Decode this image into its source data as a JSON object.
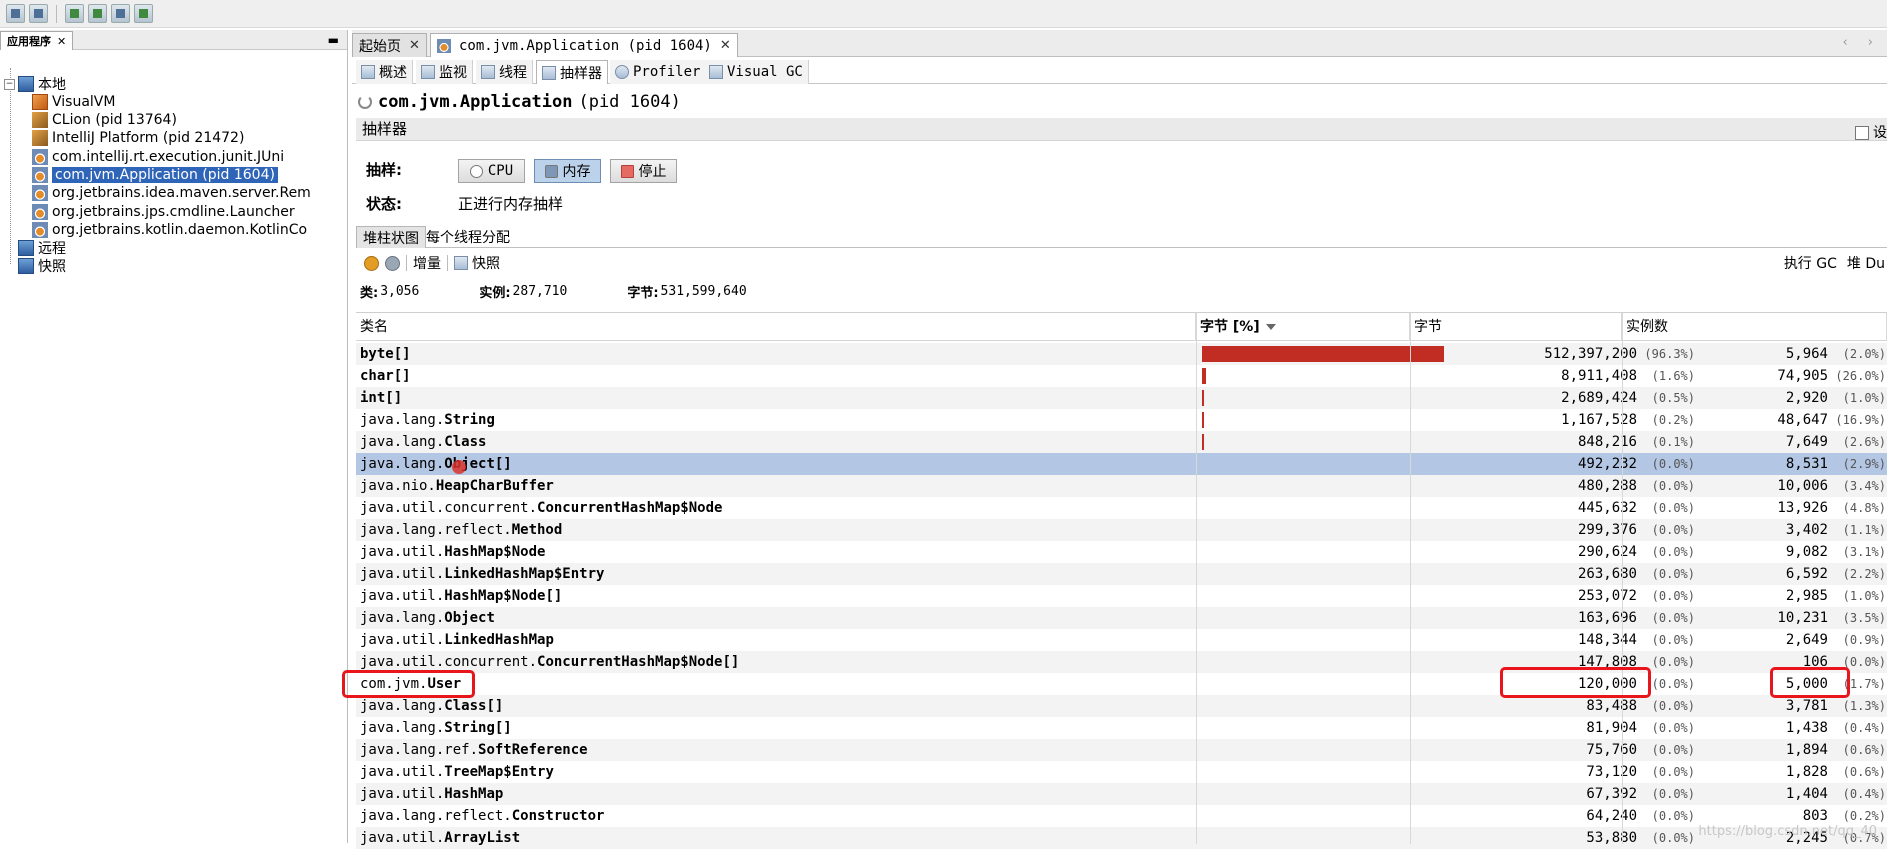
{
  "left_panel": {
    "tab_label": "应用程序",
    "tab_close": "✕",
    "minimize": "▬",
    "local": "本地",
    "remote": "远程",
    "snapshots": "快照",
    "items": [
      {
        "label": "VisualVM"
      },
      {
        "label": "CLion (pid 13764)"
      },
      {
        "label": "IntelliJ Platform (pid 21472)"
      },
      {
        "label": "com.intellij.rt.execution.junit.JUni"
      },
      {
        "label": "com.jvm.Application (pid 1604)"
      },
      {
        "label": "org.jetbrains.idea.maven.server.Rem"
      },
      {
        "label": "org.jetbrains.jps.cmdline.Launcher"
      },
      {
        "label": "org.jetbrains.kotlin.daemon.KotlinCo"
      }
    ]
  },
  "doc_tabs": {
    "start_page": "起始页",
    "app_tab": "com.jvm.Application (pid 1604)",
    "close": "✕",
    "nav": "‹ ›"
  },
  "sub_tabs": [
    "概述",
    "监视",
    "线程",
    "抽样器",
    "Profiler",
    "Visual GC"
  ],
  "app_title": {
    "name": "com.jvm.Application",
    "pid": "(pid 1604)"
  },
  "sampler": {
    "header": "抽样器",
    "settings": "设",
    "sample_label": "抽样:",
    "cpu_btn": "CPU",
    "mem_btn": "内存",
    "stop_btn": "停止",
    "status_label": "状态:",
    "status_value": "正进行内存抽样"
  },
  "view_tabs": [
    "堆柱状图",
    "每个线程分配"
  ],
  "tools": {
    "delta": "增量",
    "snapshot": "快照",
    "gc": "执行 GC",
    "heap": "堆 Du"
  },
  "stats": {
    "classes_label": "类:",
    "classes": "3,056",
    "instances_label": "实例:",
    "instances": "287,710",
    "bytes_label": "字节:",
    "bytes": "531,599,640"
  },
  "table": {
    "columns": {
      "name": "类名",
      "bytes_pct": "字节 [%]",
      "bytes": "字节",
      "instances": "实例数"
    },
    "rows": [
      {
        "pkg": "",
        "cls": "byte[]",
        "bytes": "512,397,200",
        "bpct": "(96.3%)",
        "inst": "5,964",
        "ipct": "(2.0%)",
        "share": 0.963
      },
      {
        "pkg": "",
        "cls": "char[]",
        "bytes": "8,911,408",
        "bpct": "(1.6%)",
        "inst": "74,905",
        "ipct": "(26.0%)",
        "share": 0.016
      },
      {
        "pkg": "",
        "cls": "int[]",
        "bytes": "2,689,424",
        "bpct": "(0.5%)",
        "inst": "2,920",
        "ipct": "(1.0%)",
        "share": 0.005
      },
      {
        "pkg": "java.lang.",
        "cls": "String",
        "bytes": "1,167,528",
        "bpct": "(0.2%)",
        "inst": "48,647",
        "ipct": "(16.9%)",
        "share": 0.002
      },
      {
        "pkg": "java.lang.",
        "cls": "Class",
        "bytes": "848,216",
        "bpct": "(0.1%)",
        "inst": "7,649",
        "ipct": "(2.6%)",
        "share": 0.001
      },
      {
        "pkg": "java.lang.",
        "cls": "Object[]",
        "bytes": "492,232",
        "bpct": "(0.0%)",
        "inst": "8,531",
        "ipct": "(2.9%)",
        "share": 0
      },
      {
        "pkg": "java.nio.",
        "cls": "HeapCharBuffer",
        "bytes": "480,288",
        "bpct": "(0.0%)",
        "inst": "10,006",
        "ipct": "(3.4%)",
        "share": 0
      },
      {
        "pkg": "java.util.concurrent.",
        "cls": "ConcurrentHashMap$Node",
        "bytes": "445,632",
        "bpct": "(0.0%)",
        "inst": "13,926",
        "ipct": "(4.8%)",
        "share": 0
      },
      {
        "pkg": "java.lang.reflect.",
        "cls": "Method",
        "bytes": "299,376",
        "bpct": "(0.0%)",
        "inst": "3,402",
        "ipct": "(1.1%)",
        "share": 0
      },
      {
        "pkg": "java.util.",
        "cls": "HashMap$Node",
        "bytes": "290,624",
        "bpct": "(0.0%)",
        "inst": "9,082",
        "ipct": "(3.1%)",
        "share": 0
      },
      {
        "pkg": "java.util.",
        "cls": "LinkedHashMap$Entry",
        "bytes": "263,680",
        "bpct": "(0.0%)",
        "inst": "6,592",
        "ipct": "(2.2%)",
        "share": 0
      },
      {
        "pkg": "java.util.",
        "cls": "HashMap$Node[]",
        "bytes": "253,072",
        "bpct": "(0.0%)",
        "inst": "2,985",
        "ipct": "(1.0%)",
        "share": 0
      },
      {
        "pkg": "java.lang.",
        "cls": "Object",
        "bytes": "163,696",
        "bpct": "(0.0%)",
        "inst": "10,231",
        "ipct": "(3.5%)",
        "share": 0
      },
      {
        "pkg": "java.util.",
        "cls": "LinkedHashMap",
        "bytes": "148,344",
        "bpct": "(0.0%)",
        "inst": "2,649",
        "ipct": "(0.9%)",
        "share": 0
      },
      {
        "pkg": "java.util.concurrent.",
        "cls": "ConcurrentHashMap$Node[]",
        "bytes": "147,808",
        "bpct": "(0.0%)",
        "inst": "106",
        "ipct": "(0.0%)",
        "share": 0
      },
      {
        "pkg": "com.jvm.",
        "cls": "User",
        "bytes": "120,000",
        "bpct": "(0.0%)",
        "inst": "5,000",
        "ipct": "(1.7%)",
        "share": 0
      },
      {
        "pkg": "java.lang.",
        "cls": "Class[]",
        "bytes": "83,488",
        "bpct": "(0.0%)",
        "inst": "3,781",
        "ipct": "(1.3%)",
        "share": 0
      },
      {
        "pkg": "java.lang.",
        "cls": "String[]",
        "bytes": "81,904",
        "bpct": "(0.0%)",
        "inst": "1,438",
        "ipct": "(0.4%)",
        "share": 0
      },
      {
        "pkg": "java.lang.ref.",
        "cls": "SoftReference",
        "bytes": "75,760",
        "bpct": "(0.0%)",
        "inst": "1,894",
        "ipct": "(0.6%)",
        "share": 0
      },
      {
        "pkg": "java.util.",
        "cls": "TreeMap$Entry",
        "bytes": "73,120",
        "bpct": "(0.0%)",
        "inst": "1,828",
        "ipct": "(0.6%)",
        "share": 0
      },
      {
        "pkg": "java.util.",
        "cls": "HashMap",
        "bytes": "67,392",
        "bpct": "(0.0%)",
        "inst": "1,404",
        "ipct": "(0.4%)",
        "share": 0
      },
      {
        "pkg": "java.lang.reflect.",
        "cls": "Constructor",
        "bytes": "64,240",
        "bpct": "(0.0%)",
        "inst": "803",
        "ipct": "(0.2%)",
        "share": 0
      },
      {
        "pkg": "java.util.",
        "cls": "ArrayList",
        "bytes": "53,880",
        "bpct": "(0.0%)",
        "inst": "2,245",
        "ipct": "(0.7%)",
        "share": 0
      }
    ]
  },
  "watermark": "https://blog.csdn.net/qq_40"
}
